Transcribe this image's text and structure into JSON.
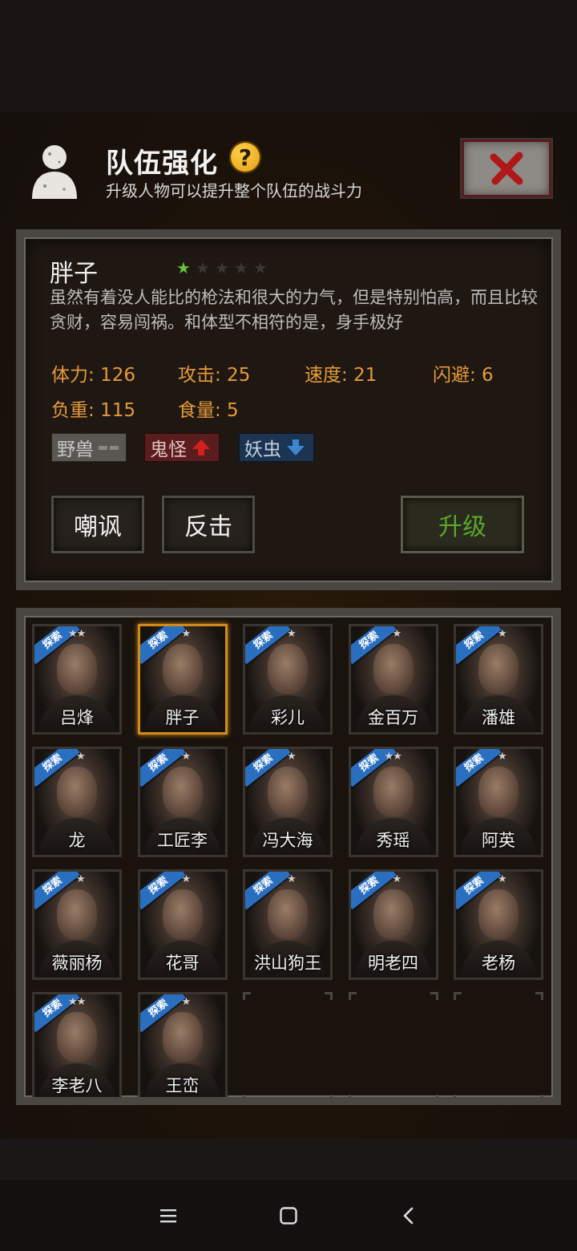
{
  "header": {
    "title": "队伍强化",
    "help_icon": "question-mark-icon",
    "subtitle": "升级人物可以提升整个队伍的战斗力",
    "close_icon": "close-x-icon"
  },
  "character": {
    "name": "胖子",
    "stars_filled": 1,
    "stars_total": 5,
    "description": "虽然有着没人能比的枪法和很大的力气，但是特别怕高，而且比较贪财，容易闯祸。和体型不相符的是，身手极好",
    "stats": {
      "stamina": "体力: 126",
      "attack": "攻击: 25",
      "speed": "速度: 21",
      "dodge": "闪避: 6",
      "load": "负重: 115",
      "food": "食量: 5"
    },
    "tags": [
      {
        "label": "野兽",
        "indicator": "neutral-dash-icon",
        "color": "#5a5652"
      },
      {
        "label": "鬼怪",
        "indicator": "arrow-up-icon",
        "color": "#5a1c1c"
      },
      {
        "label": "妖虫",
        "indicator": "arrow-down-icon",
        "color": "#1c3452"
      }
    ],
    "skills": [
      "嘲讽",
      "反击"
    ],
    "upgrade_label": "升级"
  },
  "roster": {
    "badge_label": "探索",
    "members": [
      {
        "name": "吕烽",
        "stars": 2
      },
      {
        "name": "胖子",
        "stars": 1,
        "selected": true
      },
      {
        "name": "彩儿",
        "stars": 1
      },
      {
        "name": "金百万",
        "stars": 1
      },
      {
        "name": "潘雄",
        "stars": 1
      },
      {
        "name": "龙",
        "stars": 1
      },
      {
        "name": "工匠李",
        "stars": 1
      },
      {
        "name": "冯大海",
        "stars": 1
      },
      {
        "name": "秀瑶",
        "stars": 2
      },
      {
        "name": "阿英",
        "stars": 1
      },
      {
        "name": "薇丽杨",
        "stars": 1
      },
      {
        "name": "花哥",
        "stars": 1
      },
      {
        "name": "洪山狗王",
        "stars": 1
      },
      {
        "name": "明老四",
        "stars": 1
      },
      {
        "name": "老杨",
        "stars": 1
      },
      {
        "name": "李老八",
        "stars": 2
      },
      {
        "name": "王峦",
        "stars": 1
      }
    ],
    "empty_slots": 3
  },
  "nav": {
    "menu_icon": "menu-lines-icon",
    "home_icon": "square-home-icon",
    "back_icon": "back-chevron-icon"
  },
  "colors": {
    "stat_text": "#e69a3a",
    "upgrade_text": "#5aa828",
    "selected_border": "#d08a1c",
    "explore_badge": "#2a6fbf",
    "star_on": "#6ac238"
  }
}
